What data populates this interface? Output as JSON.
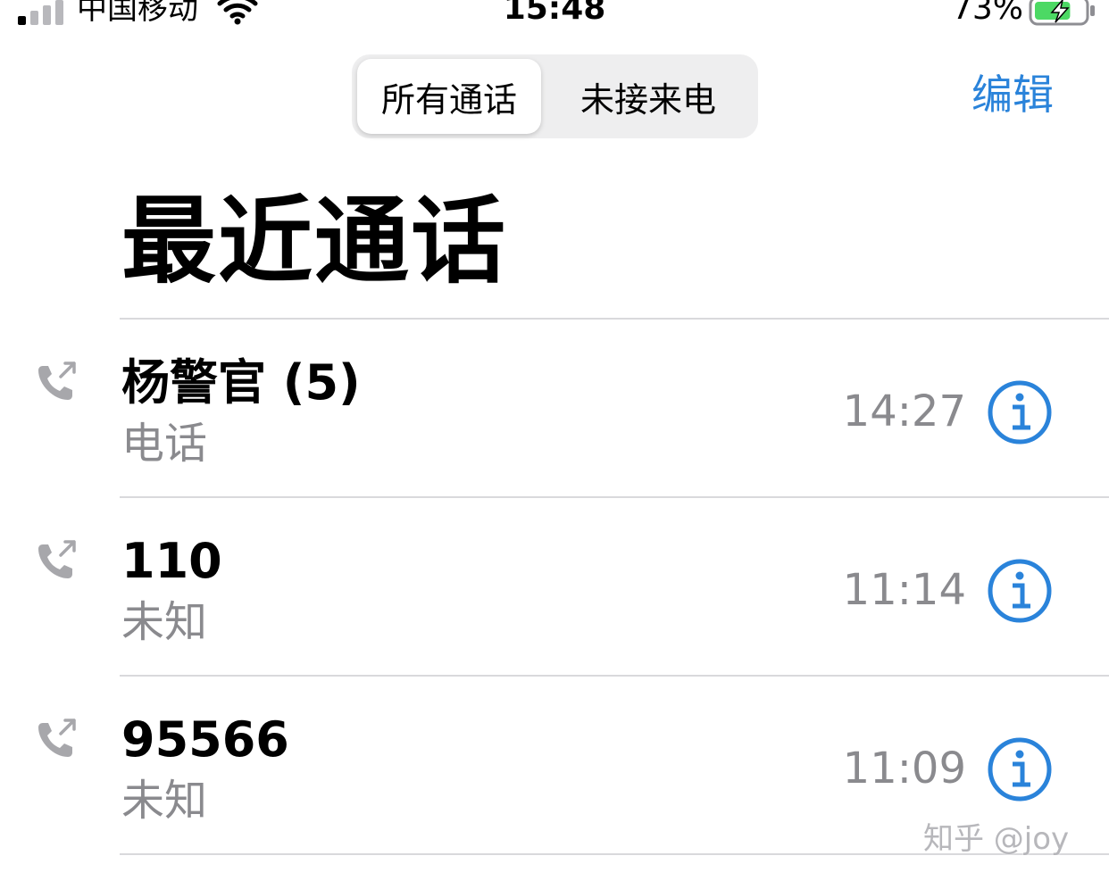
{
  "colors": {
    "accent": "#2a83da",
    "secondary_text": "#8a8a8e",
    "icon_gray": "#a7a7ab",
    "battery_green": "#4cd964"
  },
  "status_bar": {
    "carrier": "中国移动",
    "time": "15:48",
    "battery_percent": "73%",
    "battery_level": 0.73,
    "icons": [
      "cellular-signal-icon",
      "wifi-icon",
      "battery-charging-icon"
    ]
  },
  "nav": {
    "segments": [
      {
        "label": "所有通话",
        "selected": true
      },
      {
        "label": "未接来电",
        "selected": false
      }
    ],
    "edit_label": "编辑"
  },
  "title": "最近通话",
  "calls": [
    {
      "name": "杨警官 (5)",
      "type": "电话",
      "time": "14:27",
      "icon": "outgoing-call-icon"
    },
    {
      "name": "110",
      "type": "未知",
      "time": "11:14",
      "icon": "outgoing-call-icon"
    },
    {
      "name": "95566",
      "type": "未知",
      "time": "11:09",
      "icon": "outgoing-call-icon"
    }
  ],
  "watermark": "知乎 @joy"
}
